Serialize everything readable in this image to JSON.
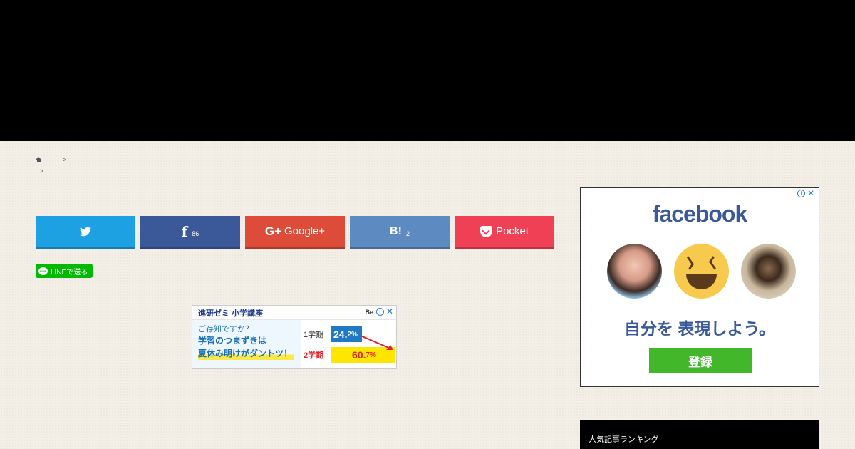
{
  "breadcrumb": {
    "sep1": ">",
    "sep2": ">"
  },
  "share": {
    "facebook_count": "86",
    "google_label": "Google+",
    "hatena_label": "B!",
    "hatena_count": "2",
    "pocket_label": "Pocket"
  },
  "line": {
    "label": "LINEで送る",
    "icon_text": "LINE"
  },
  "ad_banner": {
    "title": "進研ゼミ 小学講座",
    "brand": "Be",
    "question": "ご存知ですか？",
    "line1": "学習のつまずきは",
    "line2": "夏休み明けがダントツ！",
    "term1_label": "1学期",
    "term1_value": "24.",
    "term1_value_small": "2%",
    "term2_label": "2学期",
    "term2_value": "60.",
    "term2_value_small": "7%"
  },
  "fb_ad": {
    "logo": "facebook",
    "tagline": "自分を 表現しよう。",
    "button": "登録"
  },
  "ad_controls": {
    "info": "i",
    "close": "✕"
  },
  "sidebar": {
    "widget_title": "人気記事ランキング"
  },
  "colors": {
    "twitter": "#1ea1e2",
    "facebook": "#3b5998",
    "google": "#dd4b39",
    "hatena": "#5d8ac1",
    "pocket": "#ef4056",
    "line": "#00b900",
    "fb_register": "#42b72a"
  }
}
